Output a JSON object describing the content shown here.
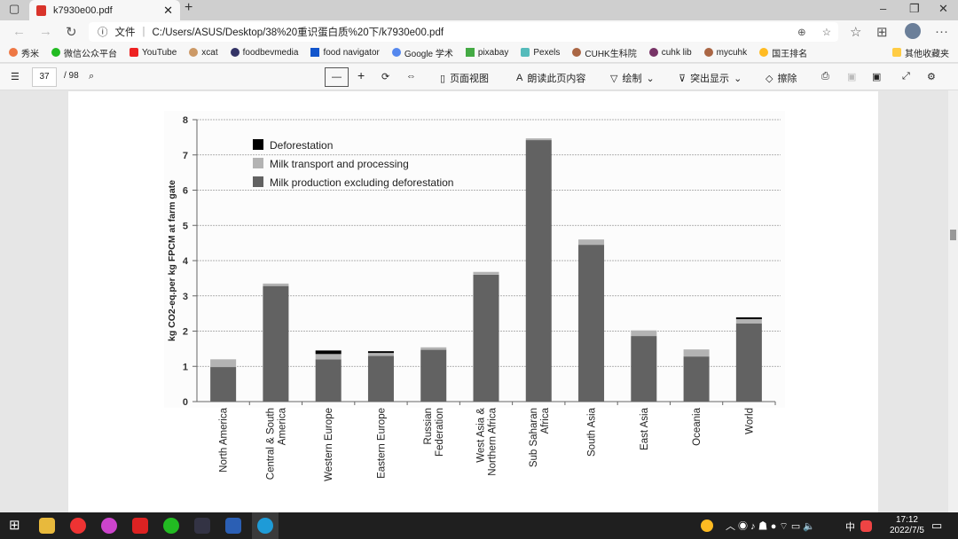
{
  "browser": {
    "tab_title": "k7930e00.pdf",
    "url_prefix": "文件",
    "url": "C:/Users/ASUS/Desktop/38%20重识蛋白质%20下/k7930e00.pdf",
    "bookmarks": [
      "秀米",
      "微信公众平台",
      "YouTube",
      "xcat",
      "foodbevmedia",
      "food navigator",
      "Google 学术",
      "pixabay",
      "Pexels",
      "CUHK生科院",
      "cuhk lib",
      "mycuhk",
      "国王排名"
    ],
    "other_bookmarks": "其他收藏夹"
  },
  "pdf_toolbar": {
    "page": "37",
    "total": "/ 98",
    "page_view": "页面视图",
    "read_aloud": "朗读此页内容",
    "draw": "绘制",
    "highlight": "突出显示",
    "erase": "擦除"
  },
  "taskbar": {
    "time": "17:12",
    "date": "2022/7/5",
    "ime": "中"
  },
  "colors": {
    "production": "#626262",
    "transport": "#b3b3b3",
    "deforestation": "#000000"
  },
  "chart_data": {
    "type": "bar",
    "stacked": true,
    "ylabel": "kg CO2-eq.per kg FPCM at farm gate",
    "ylim": [
      0,
      8
    ],
    "yticks": [
      "0",
      "1",
      "2",
      "3",
      "4",
      "5",
      "6",
      "7",
      "8"
    ],
    "grid": true,
    "legend_position": "top-left",
    "categories": [
      "North America",
      "Central & South America",
      "Western Europe",
      "Eastern Europe",
      "Russian Federation",
      "West Asia & Northern Africa",
      "Sub Saharan Africa",
      "South Asia",
      "East Asia",
      "Oceania",
      "World"
    ],
    "category_lines": [
      [
        "North America"
      ],
      [
        "Central & South",
        "America"
      ],
      [
        "Western Europe"
      ],
      [
        "Eastern Europe"
      ],
      [
        "Russian",
        "Federation"
      ],
      [
        "West Asia &",
        "Northern Africa"
      ],
      [
        "Sub Saharan",
        "Africa"
      ],
      [
        "South Asia"
      ],
      [
        "East Asia"
      ],
      [
        "Oceania"
      ],
      [
        "World"
      ]
    ],
    "series": [
      {
        "name": "Milk production excluding deforestation",
        "values": [
          0.98,
          3.28,
          1.2,
          1.3,
          1.47,
          3.6,
          7.42,
          4.45,
          1.86,
          1.28,
          2.22
        ]
      },
      {
        "name": "Milk transport and processing",
        "values": [
          0.22,
          0.07,
          0.15,
          0.08,
          0.07,
          0.08,
          0.05,
          0.15,
          0.16,
          0.2,
          0.12
        ]
      },
      {
        "name": "Deforestation",
        "values": [
          0,
          0,
          0.1,
          0.05,
          0,
          0,
          0,
          0,
          0,
          0,
          0.05
        ]
      }
    ],
    "legend": [
      "Deforestation",
      "Milk transport and processing",
      "Milk production excluding deforestation"
    ]
  }
}
